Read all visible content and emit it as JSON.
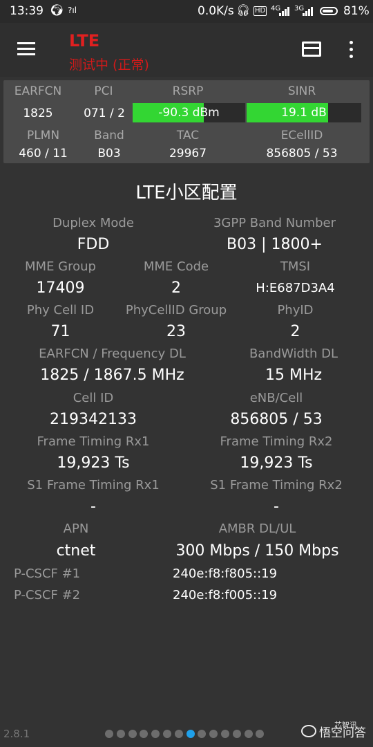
{
  "status_bar": {
    "time": "13:39",
    "speed": "0.0K/s",
    "battery": "81%",
    "battery_level": 0.81,
    "net1": "4G",
    "net2": "3G"
  },
  "app_bar": {
    "title": "LTE",
    "subtitle": "测试中 (正常)",
    "title_color": "#e02020"
  },
  "summary": {
    "headers_row1": [
      "EARFCN",
      "PCI",
      "RSRP",
      "SINR"
    ],
    "values_row1": {
      "earfcn": "1825",
      "pci": "071 / 2"
    },
    "rsrp": {
      "text": "-90.3 dBm",
      "fill_fraction": 0.63
    },
    "sinr": {
      "text": "19.1 dB",
      "fill_fraction": 0.71
    },
    "headers_row2": [
      "PLMN",
      "Band",
      "TAC",
      "ECellID"
    ],
    "values_row2": [
      "460 / 11",
      "B03",
      "29967",
      "856805 / 53"
    ],
    "meter_color": "#33d633"
  },
  "config": {
    "title": "LTE小区配置",
    "duplex_mode": {
      "label": "Duplex Mode",
      "value": "FDD"
    },
    "band_number": {
      "label": "3GPP Band Number",
      "value": "B03 | 1800+"
    },
    "mme_group": {
      "label": "MME Group",
      "value": "17409"
    },
    "mme_code": {
      "label": "MME Code",
      "value": "2"
    },
    "tmsi": {
      "label": "TMSI",
      "value": "H:E687D3A4"
    },
    "phy_cell_id": {
      "label": "Phy Cell ID",
      "value": "71"
    },
    "phy_cell_id_group": {
      "label": "PhyCellID Group",
      "value": "23"
    },
    "phy_id": {
      "label": "PhyID",
      "value": "2"
    },
    "earfcn_freq": {
      "label": "EARFCN / Frequency DL",
      "value": "1825 / 1867.5 MHz"
    },
    "bandwidth": {
      "label": "BandWidth DL",
      "value": "15 MHz"
    },
    "cell_id": {
      "label": "Cell ID",
      "value": "219342133"
    },
    "enb_cell": {
      "label": "eNB/Cell",
      "value": "856805 / 53"
    },
    "frame_timing_rx1": {
      "label": "Frame Timing Rx1",
      "value": "19,923 Ts"
    },
    "frame_timing_rx2": {
      "label": "Frame Timing Rx2",
      "value": "19,923 Ts"
    },
    "s1_frame_timing_rx1": {
      "label": "S1 Frame Timing Rx1",
      "value": "-"
    },
    "s1_frame_timing_rx2": {
      "label": "S1 Frame Timing Rx2",
      "value": "-"
    },
    "apn": {
      "label": "APN",
      "value": "ctnet"
    },
    "ambr": {
      "label": "AMBR DL/UL",
      "value": "300 Mbps / 150 Mbps"
    },
    "pcscf1": {
      "label": "P-CSCF #1",
      "value": "240e:f8:f805::19"
    },
    "pcscf2": {
      "label": "P-CSCF #2",
      "value": "240e:f8:f005::19"
    }
  },
  "footer": {
    "version": "2.8.1",
    "page_count": 14,
    "active_page": 8,
    "active_color": "#1fa0ea",
    "watermark_top": "芯智讯",
    "watermark": "悟空问答"
  }
}
